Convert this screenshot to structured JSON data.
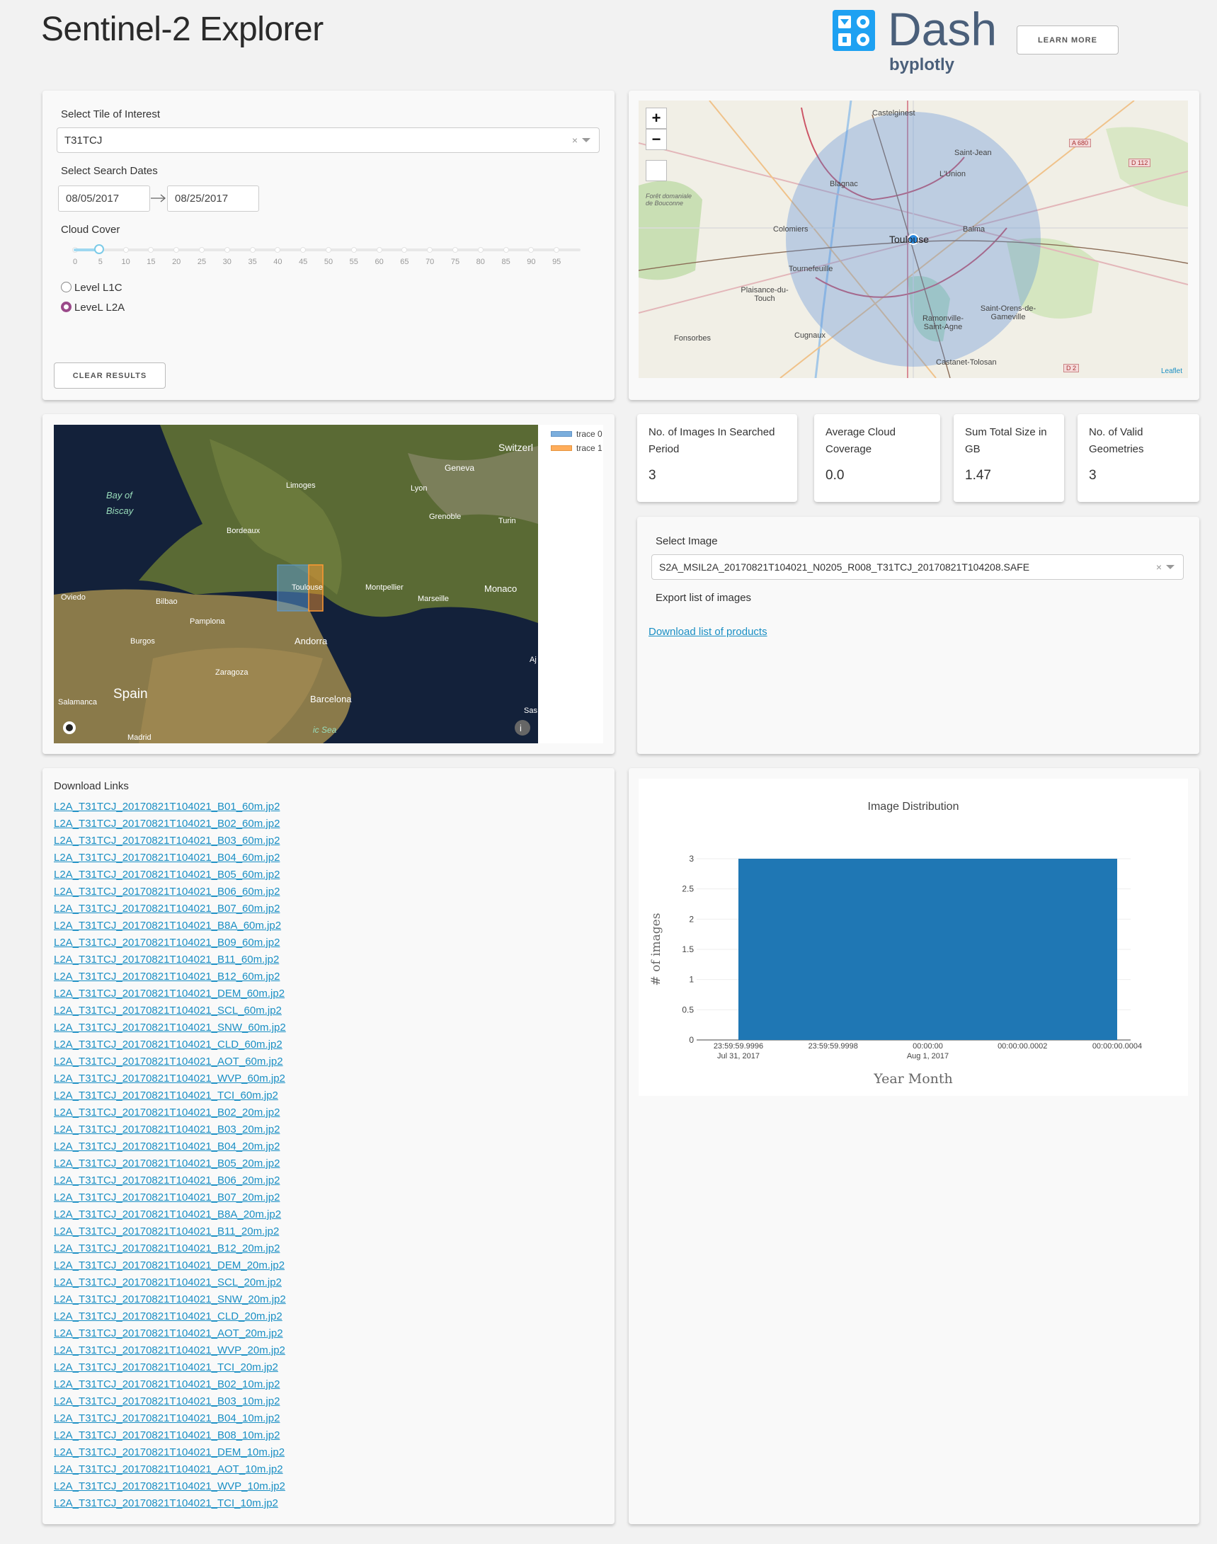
{
  "header": {
    "title": "Sentinel-2 Explorer",
    "logo_word": "Dash",
    "logo_by": "byplotly",
    "learn_more": "LEARN MORE"
  },
  "controls": {
    "tile_label": "Select Tile of Interest",
    "tile_value": "T31TCJ",
    "dates_label": "Select Search Dates",
    "start_date": "08/05/2017",
    "end_date": "08/25/2017",
    "cloud_label": "Cloud Cover",
    "cloud_value": 5,
    "cloud_ticks": [
      "0",
      "5",
      "10",
      "15",
      "20",
      "25",
      "30",
      "35",
      "40",
      "45",
      "50",
      "55",
      "60",
      "65",
      "70",
      "75",
      "80",
      "85",
      "90",
      "95"
    ],
    "level_l1c": "Level L1C",
    "level_l2a": "LeveL L2A",
    "level_selected": "LeveL L2A",
    "clear_results": "CLEAR RESULTS"
  },
  "top_map": {
    "zoom_in": "+",
    "zoom_out": "−",
    "attribution": "Leaflet",
    "place_labels": [
      "Castelginest",
      "Saint-Jean",
      "L'Union",
      "Blagnac",
      "Balma",
      "Colomiers",
      "Toulouse",
      "Tournefeuille",
      "Plaisance-du-Touch",
      "Ramonville-Saint-Agne",
      "Saint-Orens-de-Gameville",
      "Fonsorbes",
      "Cugnaux",
      "Castanet-Tolosan",
      "Forêt domaniale de Bouconne",
      "A 680",
      "D 112",
      "D 2"
    ]
  },
  "sat_map": {
    "legend": [
      "trace 0",
      "trace 1"
    ],
    "place_labels": [
      "Geneva",
      "Switzerl",
      "Bay of",
      "Biscay",
      "Limoges",
      "Lyon",
      "Grenoble",
      "Turin",
      "Bordeaux",
      "Oviedo",
      "Bilbao",
      "Toulouse",
      "Montpellier",
      "Marseille",
      "Monaco",
      "Pamplona",
      "Andorra",
      "Burgos",
      "Zaragoza",
      "Spain",
      "Salamanca",
      "Barcelona",
      "Madrid",
      "Aj",
      "Sas",
      "ic Sea"
    ]
  },
  "kpis": [
    {
      "title": "No. of Images In Searched Period",
      "value": "3"
    },
    {
      "title": "Average Cloud Coverage",
      "value": "0.0"
    },
    {
      "title": "Sum Total Size in GB",
      "value": "1.47"
    },
    {
      "title": "No. of Valid Geometries",
      "value": "3"
    }
  ],
  "image_panel": {
    "select_label": "Select Image",
    "selected_image": "S2A_MSIL2A_20170821T104021_N0205_R008_T31TCJ_20170821T104208.SAFE",
    "export_label": "Export list of images",
    "download_list": "Download list of products"
  },
  "download": {
    "title": "Download Links",
    "links": [
      "L2A_T31TCJ_20170821T104021_B01_60m.jp2",
      "L2A_T31TCJ_20170821T104021_B02_60m.jp2",
      "L2A_T31TCJ_20170821T104021_B03_60m.jp2",
      "L2A_T31TCJ_20170821T104021_B04_60m.jp2",
      "L2A_T31TCJ_20170821T104021_B05_60m.jp2",
      "L2A_T31TCJ_20170821T104021_B06_60m.jp2",
      "L2A_T31TCJ_20170821T104021_B07_60m.jp2",
      "L2A_T31TCJ_20170821T104021_B8A_60m.jp2",
      "L2A_T31TCJ_20170821T104021_B09_60m.jp2",
      "L2A_T31TCJ_20170821T104021_B11_60m.jp2",
      "L2A_T31TCJ_20170821T104021_B12_60m.jp2",
      "L2A_T31TCJ_20170821T104021_DEM_60m.jp2",
      "L2A_T31TCJ_20170821T104021_SCL_60m.jp2",
      "L2A_T31TCJ_20170821T104021_SNW_60m.jp2",
      "L2A_T31TCJ_20170821T104021_CLD_60m.jp2",
      "L2A_T31TCJ_20170821T104021_AOT_60m.jp2",
      "L2A_T31TCJ_20170821T104021_WVP_60m.jp2",
      "L2A_T31TCJ_20170821T104021_TCI_60m.jp2",
      "L2A_T31TCJ_20170821T104021_B02_20m.jp2",
      "L2A_T31TCJ_20170821T104021_B03_20m.jp2",
      "L2A_T31TCJ_20170821T104021_B04_20m.jp2",
      "L2A_T31TCJ_20170821T104021_B05_20m.jp2",
      "L2A_T31TCJ_20170821T104021_B06_20m.jp2",
      "L2A_T31TCJ_20170821T104021_B07_20m.jp2",
      "L2A_T31TCJ_20170821T104021_B8A_20m.jp2",
      "L2A_T31TCJ_20170821T104021_B11_20m.jp2",
      "L2A_T31TCJ_20170821T104021_B12_20m.jp2",
      "L2A_T31TCJ_20170821T104021_DEM_20m.jp2",
      "L2A_T31TCJ_20170821T104021_SCL_20m.jp2",
      "L2A_T31TCJ_20170821T104021_SNW_20m.jp2",
      "L2A_T31TCJ_20170821T104021_CLD_20m.jp2",
      "L2A_T31TCJ_20170821T104021_AOT_20m.jp2",
      "L2A_T31TCJ_20170821T104021_WVP_20m.jp2",
      "L2A_T31TCJ_20170821T104021_TCI_20m.jp2",
      "L2A_T31TCJ_20170821T104021_B02_10m.jp2",
      "L2A_T31TCJ_20170821T104021_B03_10m.jp2",
      "L2A_T31TCJ_20170821T104021_B04_10m.jp2",
      "L2A_T31TCJ_20170821T104021_B08_10m.jp2",
      "L2A_T31TCJ_20170821T104021_DEM_10m.jp2",
      "L2A_T31TCJ_20170821T104021_AOT_10m.jp2",
      "L2A_T31TCJ_20170821T104021_WVP_10m.jp2",
      "L2A_T31TCJ_20170821T104021_TCI_10m.jp2"
    ]
  },
  "chart_data": {
    "type": "bar",
    "title": "Image Distribution",
    "xlabel": "Year Month",
    "ylabel": "# of images",
    "ylim": [
      0,
      3
    ],
    "yticks": [
      "0",
      "0.5",
      "1",
      "1.5",
      "2",
      "2.5",
      "3"
    ],
    "xticks": [
      {
        "line1": "23:59:59.9996",
        "line2": "Jul 31, 2017"
      },
      {
        "line1": "23:59:59.9998",
        "line2": ""
      },
      {
        "line1": "00:00:00",
        "line2": "Aug 1, 2017"
      },
      {
        "line1": "00:00:00.0002",
        "line2": ""
      },
      {
        "line1": "00:00:00.0004",
        "line2": ""
      }
    ],
    "categories": [
      "Aug 1, 2017"
    ],
    "values": [
      3
    ],
    "color": "#1f77b4",
    "grid": true
  },
  "colors": {
    "accent": "#1ea1f2",
    "link": "#1a8fc4",
    "radio": "#9b4a8a",
    "trace0": "#5b9bd5",
    "trace1": "#ff9933"
  }
}
